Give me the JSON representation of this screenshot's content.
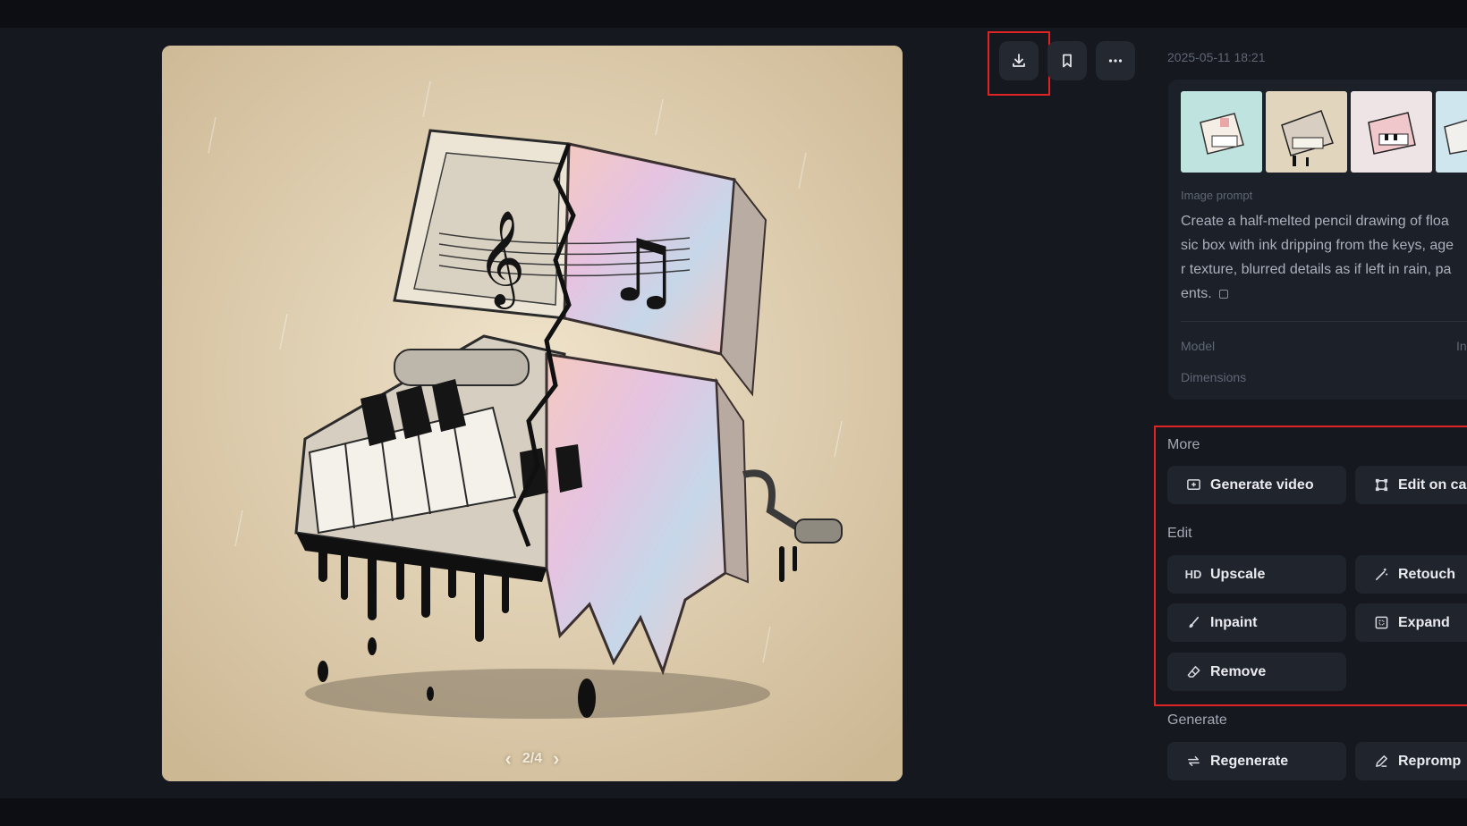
{
  "header": {
    "timestamp": "2025-05-11 18:21"
  },
  "viewer": {
    "pager": "2/4",
    "prev_icon": "chevron-left-icon",
    "next_icon": "chevron-right-icon"
  },
  "toolbar": {
    "download_icon": "download-icon",
    "bookmark_icon": "bookmark-icon",
    "more_icon": "more-horizontal-icon"
  },
  "details": {
    "thumbnails": [
      "thumbnail-1",
      "thumbnail-2",
      "thumbnail-3",
      "thumbnail-4"
    ],
    "prompt_label": "Image prompt",
    "prompt_lines": [
      "Create a half-melted pencil drawing of floa",
      "sic box with ink dripping from the keys, age",
      "r texture, blurred details as if left in rain, pa",
      "ents."
    ],
    "model_label": "Model",
    "model_value": "In",
    "dimensions_label": "Dimensions"
  },
  "sections": {
    "more": "More",
    "edit": "Edit",
    "generate": "Generate"
  },
  "actions": {
    "generate_video": "Generate video",
    "edit_on_canvas": "Edit on ca",
    "upscale": "Upscale",
    "upscale_badge": "HD",
    "retouch": "Retouch",
    "inpaint": "Inpaint",
    "expand": "Expand",
    "remove": "Remove",
    "regenerate": "Regenerate",
    "reprompt": "Repromp"
  },
  "colors": {
    "highlight": "#e02424",
    "panel": "#1c2028",
    "button": "#20242d",
    "background": "#15181f"
  }
}
